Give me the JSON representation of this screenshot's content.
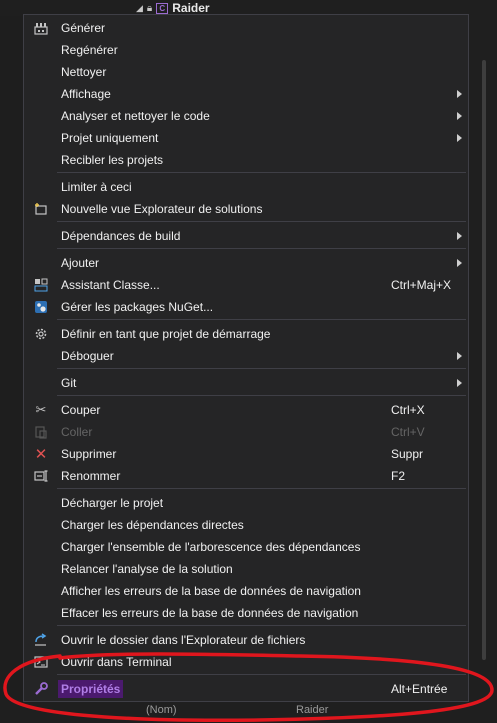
{
  "background": {
    "tree_item": {
      "name": "Raider"
    },
    "bottom_left": "(Nom)",
    "bottom_right": "Raider"
  },
  "colors": {
    "accent": "#b07ee6",
    "annotation": "#e0161d",
    "menu_bg": "#252526"
  },
  "menu": {
    "items": [
      {
        "label": "Générer",
        "icon": "build-icon"
      },
      {
        "label": "Regénérer"
      },
      {
        "label": "Nettoyer"
      },
      {
        "label": "Affichage",
        "submenu": true
      },
      {
        "label": "Analyser et nettoyer le code",
        "submenu": true
      },
      {
        "label": "Projet uniquement",
        "submenu": true
      },
      {
        "label": "Recibler les projets"
      },
      {
        "label": "Limiter à ceci"
      },
      {
        "label": "Nouvelle vue Explorateur de solutions",
        "icon": "new-view-icon"
      },
      {
        "label": "Dépendances de build",
        "submenu": true
      },
      {
        "label": "Ajouter",
        "submenu": true
      },
      {
        "label": "Assistant Classe...",
        "icon": "class-wizard-icon",
        "shortcut": "Ctrl+Maj+X"
      },
      {
        "label": "Gérer les packages NuGet...",
        "icon": "nuget-icon"
      },
      {
        "label": "Définir en tant que projet de démarrage",
        "icon": "gear-icon"
      },
      {
        "label": "Déboguer",
        "submenu": true
      },
      {
        "label": "Git",
        "submenu": true
      },
      {
        "label": "Couper",
        "icon": "scissors-icon",
        "shortcut": "Ctrl+X"
      },
      {
        "label": "Coller",
        "icon": "paste-icon",
        "shortcut": "Ctrl+V",
        "disabled": true
      },
      {
        "label": "Supprimer",
        "icon": "delete-icon",
        "shortcut": "Suppr"
      },
      {
        "label": "Renommer",
        "icon": "rename-icon",
        "shortcut": "F2"
      },
      {
        "label": "Décharger le projet"
      },
      {
        "label": "Charger les dépendances directes"
      },
      {
        "label": "Charger l'ensemble de l'arborescence des dépendances"
      },
      {
        "label": "Relancer l'analyse de la solution"
      },
      {
        "label": "Afficher les erreurs de la base de données de navigation"
      },
      {
        "label": "Effacer les erreurs de la base de données de navigation"
      },
      {
        "label": "Ouvrir le dossier dans l'Explorateur de fichiers",
        "icon": "open-folder-icon"
      },
      {
        "label": "Ouvrir dans Terminal",
        "icon": "terminal-icon"
      },
      {
        "label": "Propriétés",
        "icon": "wrench-icon",
        "shortcut": "Alt+Entrée",
        "highlighted": true
      }
    ]
  }
}
